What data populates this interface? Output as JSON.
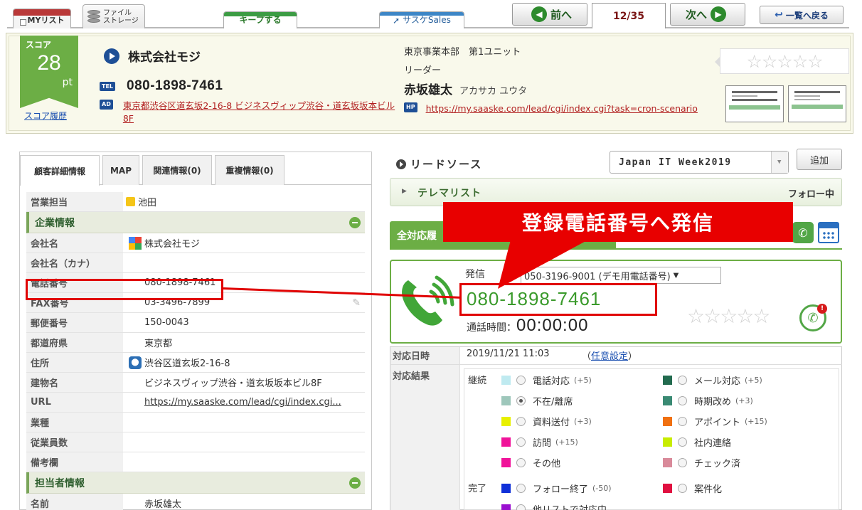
{
  "topbar": {
    "mylist_label": "MYリスト",
    "file_storage_line1": "ファイル",
    "file_storage_line2": "ストレージ",
    "keep_label": "キープする",
    "sales_label": "サスケSales",
    "prev_label": "前へ",
    "pager": "12/35",
    "next_label": "次へ",
    "back_label": "一覧へ戻る"
  },
  "header": {
    "score_label": "スコア",
    "score_value": "28",
    "score_unit": "pt",
    "score_history": "スコア履歴",
    "company_name": "株式会社モジ",
    "tel_badge": "TEL",
    "tel": "080-1898-7461",
    "addr_badge": "AD",
    "address": "東京都渋谷区道玄坂2-16-8 ビジネスヴィップ渋谷・道玄坂坂本ビル8F",
    "department": "東京事業本部　第1ユニット",
    "role": "リーダー",
    "person_name": "赤坂雄太",
    "person_kana": "アカサカ ユウタ",
    "hp_badge": "HP",
    "homepage": "https://my.saaske.com/lead/cgi/index.cgi?task=cron-scenario",
    "rating_stars": "☆☆☆☆☆"
  },
  "left_tabs": [
    "顧客詳細情報",
    "MAP",
    "関連情報(0)",
    "重複情報(0)"
  ],
  "details": {
    "sales_owner_key": "営業担当",
    "sales_owner_val": "池田",
    "company_section": "企業情報",
    "rows": [
      {
        "k": "会社名",
        "v": "株式会社モジ"
      },
      {
        "k": "会社名（カナ）",
        "v": ""
      },
      {
        "k": "電話番号",
        "v": "080-1898-7461"
      },
      {
        "k": "FAX番号",
        "v": "03-3496-7899"
      },
      {
        "k": "郵便番号",
        "v": "150-0043"
      },
      {
        "k": "都道府県",
        "v": "東京都"
      },
      {
        "k": "住所",
        "v": "渋谷区道玄坂2-16-8"
      },
      {
        "k": "建物名",
        "v": "ビジネスヴィップ渋谷・道玄坂坂本ビル8F"
      },
      {
        "k": "URL",
        "v": "https://my.saaske.com/lead/cgi/index.cgi..."
      },
      {
        "k": "業種",
        "v": ""
      },
      {
        "k": "従業員数",
        "v": ""
      },
      {
        "k": "備考欄",
        "v": ""
      }
    ],
    "contact_section": "担当者情報",
    "contact_rows": [
      {
        "k": "名前",
        "v": "赤坂雄太"
      }
    ]
  },
  "lead": {
    "title": "リードソース",
    "source": "Japan IT Week2019",
    "add_label": "追加",
    "list_name": "テレマリスト",
    "list_status": "フォロー中",
    "history_tab": "全対応履"
  },
  "callout": {
    "text": "登録電話番号へ発信"
  },
  "dial": {
    "caller_label": "発信",
    "caller_value": "050-3196-9001 (デモ用電話番号)",
    "number": "080-1898-7461",
    "time_label": "通話時間：",
    "time_value": "00:00:00",
    "stars": "☆☆☆☆☆"
  },
  "response": {
    "date_label": "対応日時",
    "date_value": "2019/11/21 11:03",
    "arbitrary_prefix": "（",
    "arbitrary_link": "任意設定",
    "arbitrary_suffix": "）",
    "result_label": "対応結果",
    "group_continue": "継続",
    "group_done": "完了",
    "options_left": [
      {
        "label": "電話対応",
        "pts": "(+5)",
        "color": "#bfeaf0",
        "selected": false
      },
      {
        "label": "不在/離席",
        "pts": "",
        "color": "#9ec7bb",
        "selected": true
      },
      {
        "label": "資料送付",
        "pts": "(+3)",
        "color": "#e8f000",
        "selected": false
      },
      {
        "label": "訪問",
        "pts": "(+15)",
        "color": "#f0139a",
        "selected": false
      },
      {
        "label": "その他",
        "pts": "",
        "color": "#f0139a",
        "selected": false
      }
    ],
    "options_right": [
      {
        "label": "メール対応",
        "pts": "(+5)",
        "color": "#226b4f",
        "selected": false
      },
      {
        "label": "時期改め",
        "pts": "(+3)",
        "color": "#3a8a73",
        "selected": false
      },
      {
        "label": "アポイント",
        "pts": "(+15)",
        "color": "#f07010",
        "selected": false
      },
      {
        "label": "社内連絡",
        "pts": "",
        "color": "#c8ec00",
        "selected": false
      },
      {
        "label": "チェック済",
        "pts": "",
        "color": "#d98a9a",
        "selected": false
      }
    ],
    "done_left": [
      {
        "label": "フォロー終了",
        "pts": "(-50)",
        "color": "#1030d8",
        "selected": false
      },
      {
        "label": "他リストで対応中",
        "pts": "",
        "color": "#9a10d0",
        "selected": false
      }
    ],
    "done_right": [
      {
        "label": "案件化",
        "pts": "",
        "color": "#e01040",
        "selected": false
      }
    ]
  }
}
